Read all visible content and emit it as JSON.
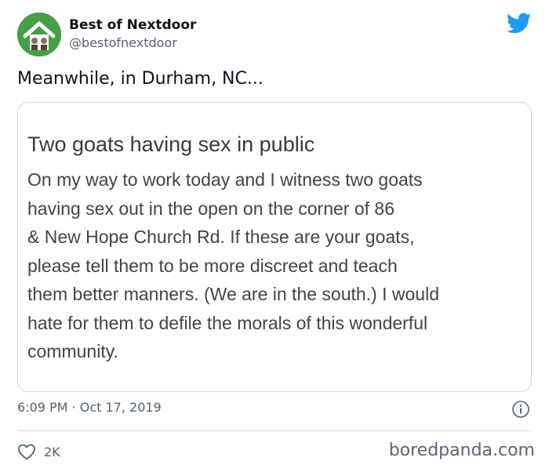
{
  "author": {
    "display_name": "Best of Nextdoor",
    "handle": "@bestofnextdoor",
    "avatar_icon": "house-logo-icon",
    "avatar_color": "#43a047"
  },
  "tweet": {
    "text": "Meanwhile, in Durham, NC..."
  },
  "card": {
    "title": "Two goats having sex in public",
    "body_lines": [
      "On my way to work today and I witness two goats",
      "having sex out in the open on the corner of 86",
      "& New Hope Church Rd. If these are your goats,",
      "please tell them to be more discreet and teach",
      "them better manners. (We are in the south.) I would",
      "hate for them to defile the morals of this wonderful",
      "community."
    ]
  },
  "meta": {
    "timestamp": "6:09 PM · Oct 17, 2019",
    "info_icon": "info-icon"
  },
  "actions": {
    "like_icon": "heart-icon",
    "like_count": "2K"
  },
  "watermark": "boredpanda.com",
  "colors": {
    "twitter_blue": "#1d9bf0",
    "secondary_text": "#536471",
    "border": "#cfd9de"
  }
}
